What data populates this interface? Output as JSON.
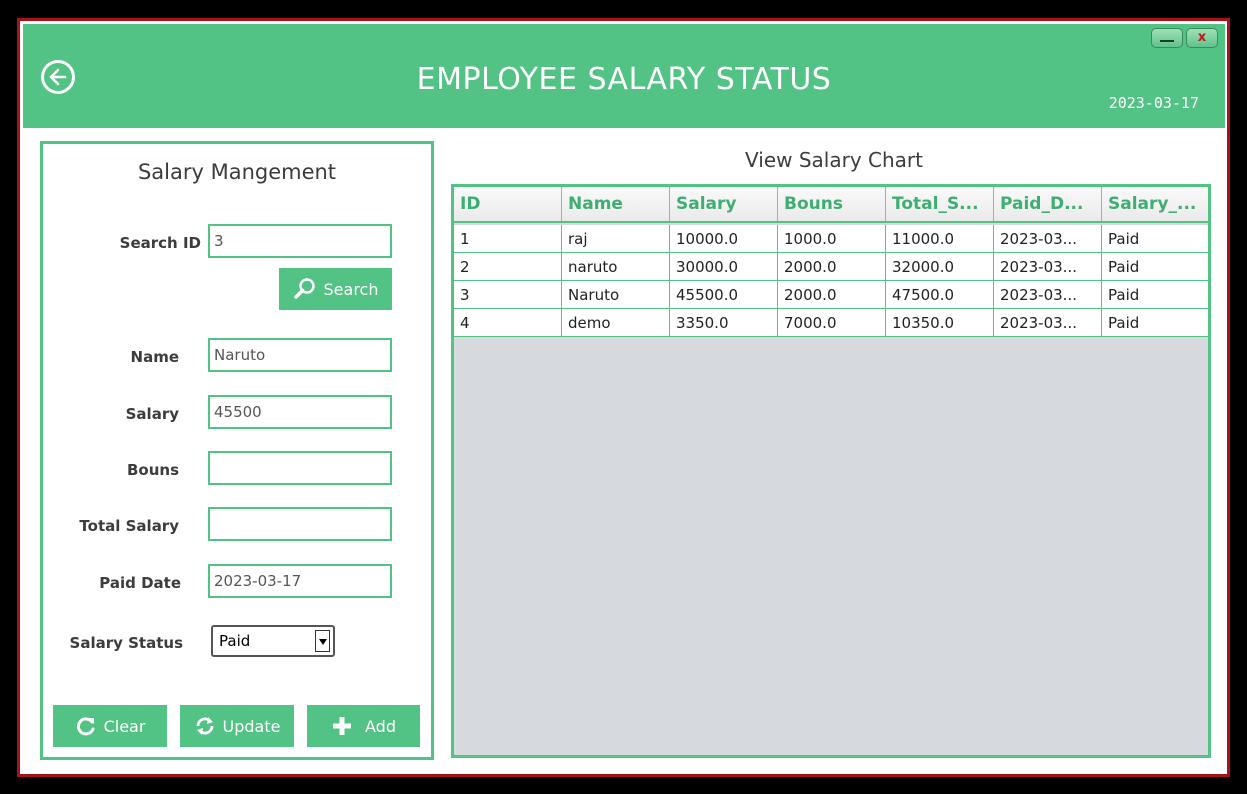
{
  "header": {
    "title": "EMPLOYEE SALARY STATUS",
    "date": "2023-03-17",
    "close_label": "x"
  },
  "form": {
    "title": "Salary Mangement",
    "search_id_label": "Search ID",
    "search_id_value": "3",
    "search_button": "Search",
    "name_label": "Name",
    "name_value": "Naruto",
    "salary_label": "Salary",
    "salary_value": "45500",
    "bonus_label": "Bouns",
    "bonus_value": "",
    "total_label": "Total Salary",
    "total_value": "",
    "paid_date_label": "Paid Date",
    "paid_date_value": "2023-03-17",
    "status_label": "Salary Status",
    "status_value": "Paid",
    "clear_button": "Clear",
    "update_button": "Update",
    "add_button": "Add"
  },
  "table": {
    "title": "View Salary Chart",
    "columns": [
      "ID",
      "Name",
      "Salary",
      "Bouns",
      "Total_S...",
      "Paid_D...",
      "Salary_..."
    ],
    "rows": [
      [
        "1",
        "raj",
        "10000.0",
        "1000.0",
        "11000.0",
        "2023-03...",
        "Paid"
      ],
      [
        "2",
        "naruto",
        "30000.0",
        "2000.0",
        "32000.0",
        "2023-03...",
        "Paid"
      ],
      [
        "3",
        "Naruto",
        "45500.0",
        "2000.0",
        "47500.0",
        "2023-03...",
        "Paid"
      ],
      [
        "4",
        "demo",
        "3350.0",
        "7000.0",
        "10350.0",
        "2023-03...",
        "Paid"
      ]
    ]
  },
  "colors": {
    "accent": "#52c384",
    "frame": "#a8101a",
    "table_bg": "#d6d9de"
  },
  "icons": [
    "back-arrow-icon",
    "minimize-icon",
    "close-icon",
    "search-icon",
    "refresh-icon",
    "sync-icon",
    "plus-icon",
    "chevron-down-icon"
  ]
}
